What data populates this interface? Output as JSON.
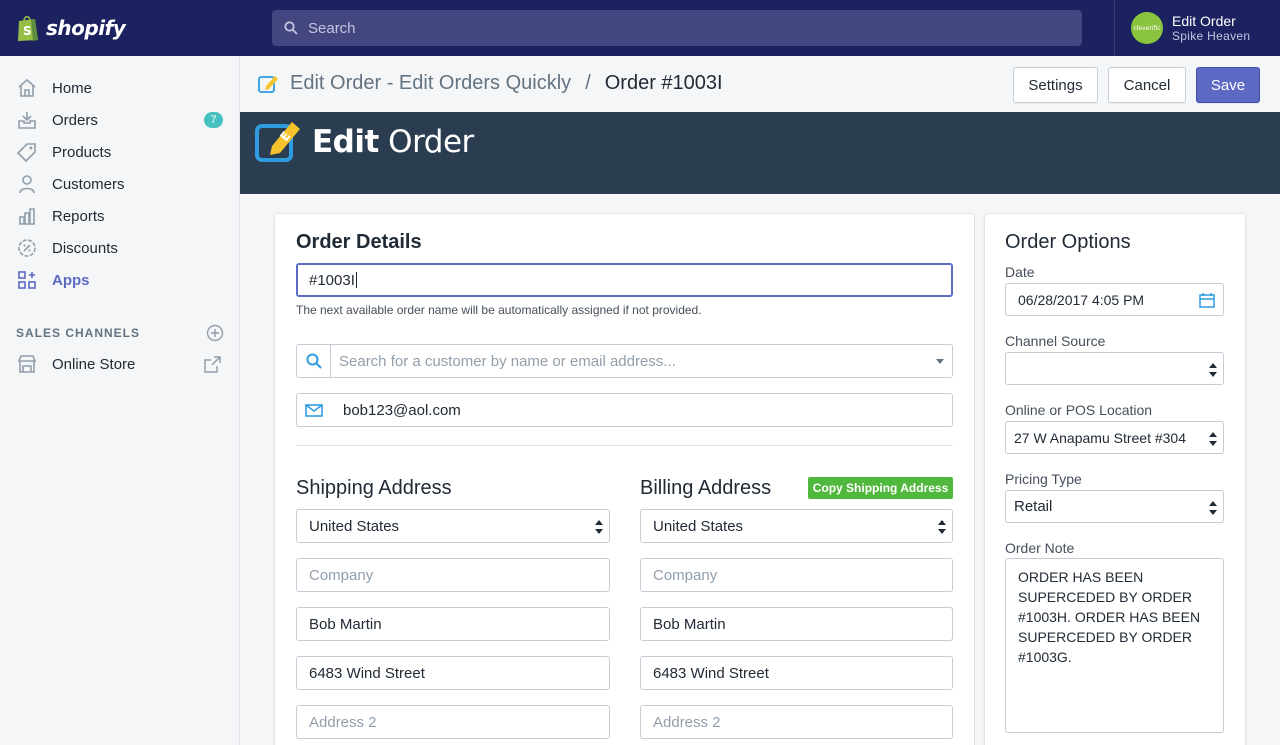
{
  "topbar": {
    "brand": "shopify",
    "search_placeholder": "Search",
    "account_name": "Edit Order",
    "account_store": "Spike Heaven",
    "avatar_text": "cleverific"
  },
  "sidebar": {
    "items": [
      {
        "label": "Home",
        "icon": "home-icon"
      },
      {
        "label": "Orders",
        "icon": "orders-icon",
        "badge": "7"
      },
      {
        "label": "Products",
        "icon": "tag-icon"
      },
      {
        "label": "Customers",
        "icon": "person-icon"
      },
      {
        "label": "Reports",
        "icon": "chart-icon"
      },
      {
        "label": "Discounts",
        "icon": "discount-icon"
      },
      {
        "label": "Apps",
        "icon": "apps-icon"
      }
    ],
    "sales_channels_title": "SALES CHANNELS",
    "online_store": "Online Store"
  },
  "pagebar": {
    "app_name": "Edit Order - Edit Orders Quickly",
    "separator": "/",
    "order_title": "Order #1003I",
    "settings_label": "Settings",
    "cancel_label": "Cancel",
    "save_label": "Save"
  },
  "hero": {
    "title_bold": "Edit",
    "title_rest": " Order"
  },
  "order_details": {
    "title": "Order Details",
    "order_name_value": "#1003I",
    "order_name_hint": "The next available order name will be automatically assigned if not provided.",
    "customer_search_placeholder": "Search for a customer by name or email address...",
    "email_value": "bob123@aol.com"
  },
  "shipping": {
    "title": "Shipping Address",
    "country": "United States",
    "company_placeholder": "Company",
    "name": "Bob Martin",
    "address1": "6483 Wind Street",
    "address2_placeholder": "Address 2"
  },
  "billing": {
    "title": "Billing Address",
    "copy_label": "Copy Shipping Address",
    "country": "United States",
    "company_placeholder": "Company",
    "name": "Bob Martin",
    "address1": "6483 Wind Street",
    "address2_placeholder": "Address 2"
  },
  "order_options": {
    "title": "Order Options",
    "date_label": "Date",
    "date_value": "06/28/2017 4:05 PM",
    "channel_label": "Channel Source",
    "channel_value": "",
    "location_label": "Online or POS Location",
    "location_value": "27 W Anapamu Street #304",
    "pricing_label": "Pricing Type",
    "pricing_value": "Retail",
    "note_label": "Order Note",
    "note_value": "ORDER HAS BEEN SUPERCEDED BY ORDER #1003H. ORDER HAS BEEN SUPERCEDED BY ORDER #1003G."
  },
  "colors": {
    "topbar": "#1c2260",
    "accent": "#5c6ac4",
    "hero": "#2a3d51",
    "badge": "#47c1bf",
    "copy_button": "#50b83c"
  }
}
